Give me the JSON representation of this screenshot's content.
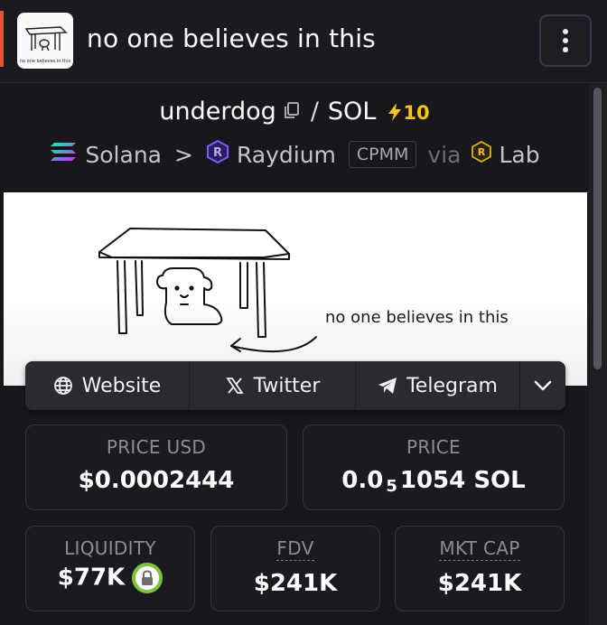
{
  "header": {
    "title": "no one believes in this",
    "logo_caption": "no one believes in this"
  },
  "pair": {
    "base": "underdog",
    "separator": "/",
    "quote": "SOL",
    "boost_count": "10"
  },
  "chain": {
    "chain_name": "Solana",
    "separator": ">",
    "dex_name": "Raydium",
    "pool_type": "CPMM",
    "via_label": "via",
    "launchpad": "Lab"
  },
  "banner": {
    "caption": "no one believes in this"
  },
  "links": {
    "website": "Website",
    "twitter": "Twitter",
    "telegram": "Telegram"
  },
  "stats": {
    "price_usd": {
      "label": "PRICE USD",
      "value": "$0.0002444"
    },
    "price_native": {
      "label": "PRICE",
      "prefix": "0.0",
      "zeros": "5",
      "digits": "1054",
      "unit": "SOL"
    },
    "liquidity": {
      "label": "LIQUIDITY",
      "value": "$77K"
    },
    "fdv": {
      "label": "FDV",
      "value": "$241K"
    },
    "mkt_cap": {
      "label": "MKT CAP",
      "value": "$241K"
    }
  },
  "colors": {
    "accent_orange": "#e4572e",
    "boost_yellow": "#f5c518",
    "lock_green": "#7fc241",
    "background": "#17171c"
  },
  "icons": {
    "copy": "copy-icon",
    "boost": "lightning-icon",
    "solana": "solana-icon",
    "raydium": "raydium-icon",
    "lab": "lab-icon",
    "website": "globe-icon",
    "twitter": "x-icon",
    "telegram": "telegram-icon",
    "more": "chevron-down-icon",
    "menu": "more-vertical-icon",
    "lock": "lock-icon"
  }
}
